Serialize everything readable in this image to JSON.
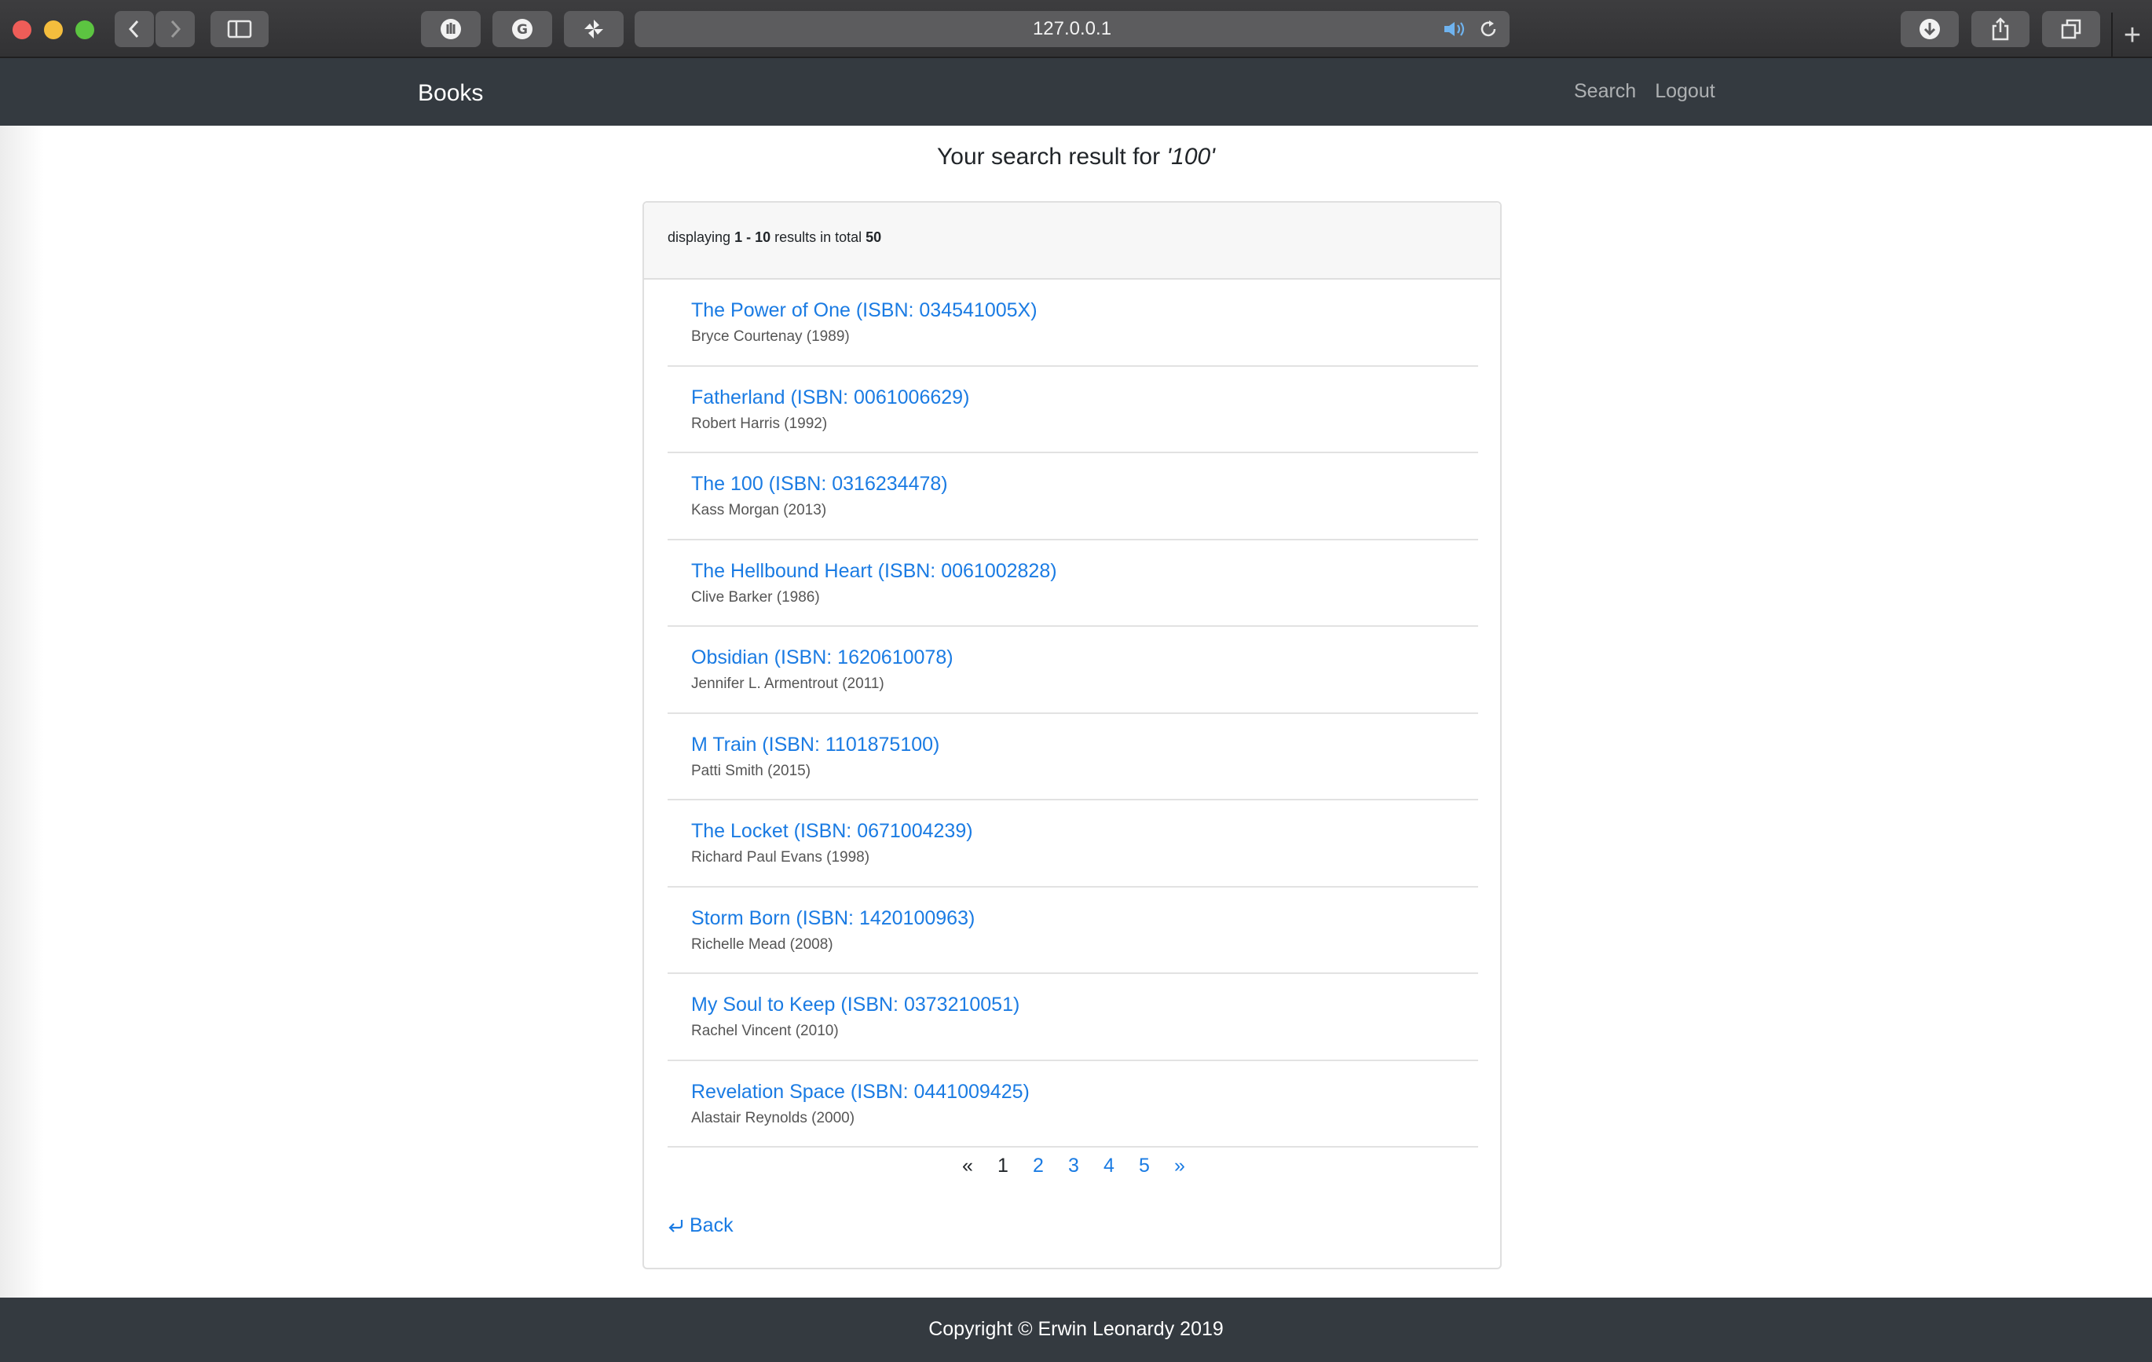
{
  "browser": {
    "url": "127.0.0.1"
  },
  "navbar": {
    "brand": "Books",
    "links": [
      "Search",
      "Logout"
    ]
  },
  "search": {
    "heading_prefix": "Your search result for ",
    "query_display": "'100'"
  },
  "results": {
    "summary_prefix": "displaying ",
    "range": "1 - 10",
    "summary_middle": " results in total ",
    "total": "50",
    "items": [
      {
        "title": "The Power of One (ISBN: 034541005X)",
        "meta": "Bryce Courtenay (1989)"
      },
      {
        "title": "Fatherland (ISBN: 0061006629)",
        "meta": "Robert Harris (1992)"
      },
      {
        "title": "The 100 (ISBN: 0316234478)",
        "meta": "Kass Morgan (2013)"
      },
      {
        "title": "The Hellbound Heart (ISBN: 0061002828)",
        "meta": "Clive Barker (1986)"
      },
      {
        "title": "Obsidian (ISBN: 1620610078)",
        "meta": "Jennifer L. Armentrout (2011)"
      },
      {
        "title": "M Train (ISBN: 1101875100)",
        "meta": "Patti Smith (2015)"
      },
      {
        "title": "The Locket (ISBN: 0671004239)",
        "meta": "Richard Paul Evans (1998)"
      },
      {
        "title": "Storm Born (ISBN: 1420100963)",
        "meta": "Richelle Mead (2008)"
      },
      {
        "title": "My Soul to Keep (ISBN: 0373210051)",
        "meta": "Rachel Vincent (2010)"
      },
      {
        "title": "Revelation Space (ISBN: 0441009425)",
        "meta": "Alastair Reynolds (2000)"
      }
    ]
  },
  "pagination": {
    "prev": "«",
    "pages": [
      "1",
      "2",
      "3",
      "4",
      "5"
    ],
    "current": "1",
    "next": "»"
  },
  "back": {
    "icon": "return-arrow-icon",
    "label": "Back"
  },
  "footer": {
    "text": "Copyright © Erwin Leonardy 2019"
  },
  "colors": {
    "link": "#1a7be3",
    "navbar": "#343a40"
  }
}
